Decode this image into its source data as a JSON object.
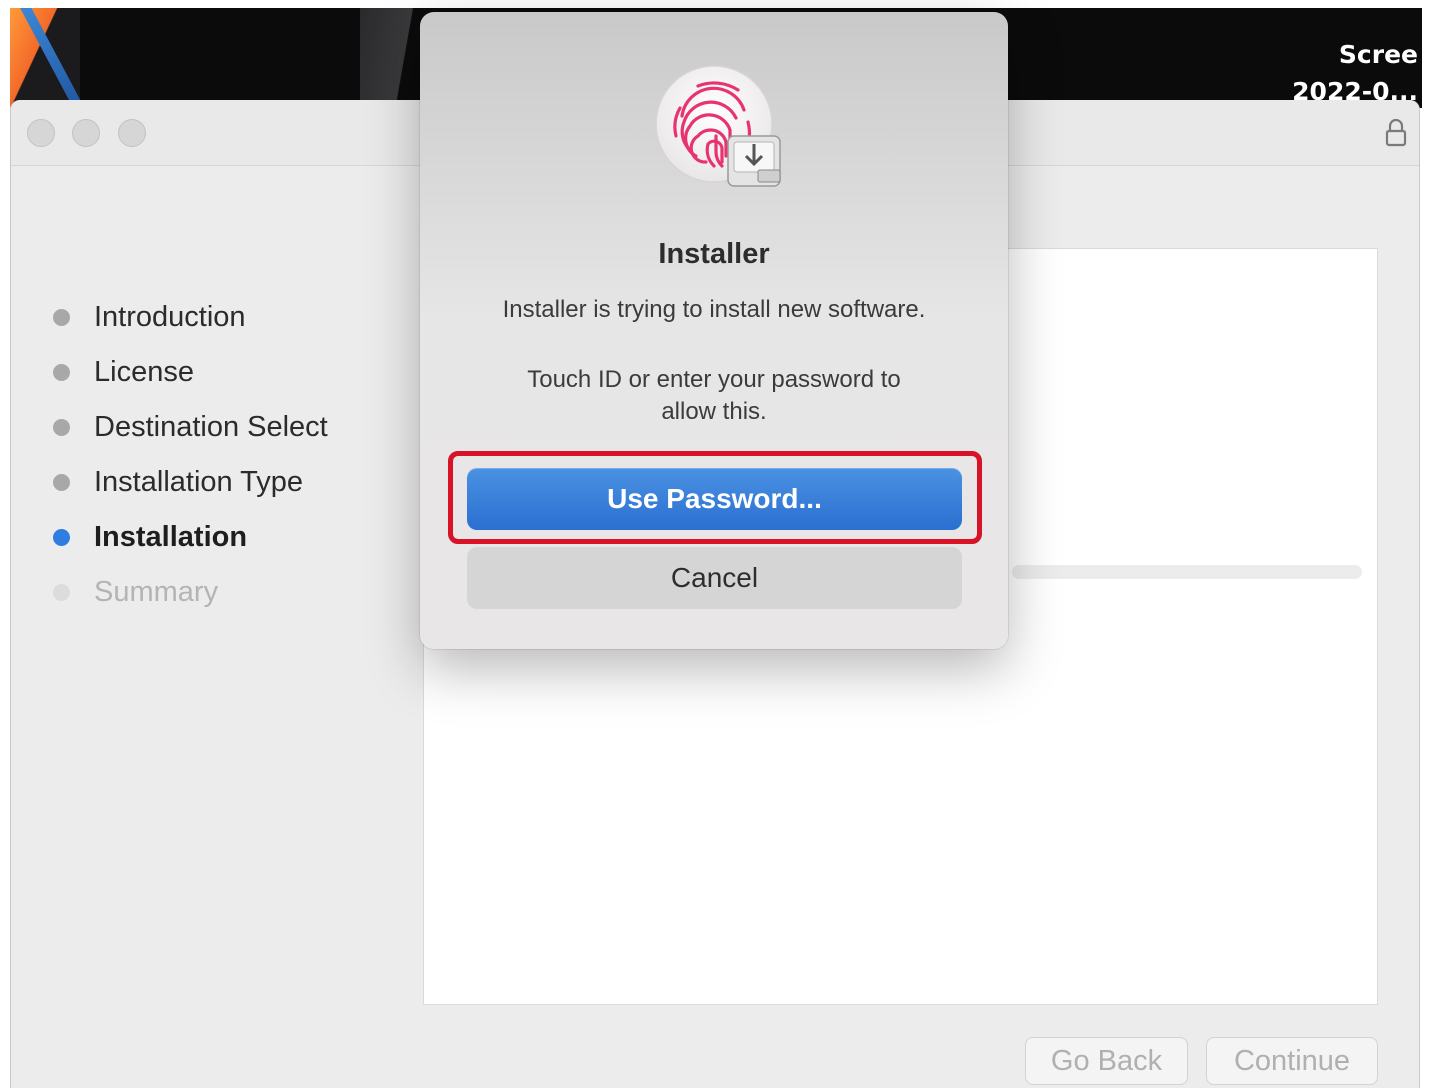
{
  "desktop": {
    "label_line1": "Scree",
    "label_line2": "2022-0..."
  },
  "window": {
    "traffic_lights": [
      "close-button",
      "minimize-button",
      "zoom-button"
    ],
    "lock_icon": "lock-icon"
  },
  "sidebar": {
    "steps": [
      {
        "label": "Introduction",
        "state": "done"
      },
      {
        "label": "License",
        "state": "done"
      },
      {
        "label": "Destination Select",
        "state": "done"
      },
      {
        "label": "Installation Type",
        "state": "done"
      },
      {
        "label": "Installation",
        "state": "current"
      },
      {
        "label": "Summary",
        "state": "pending"
      }
    ]
  },
  "footer": {
    "go_back_label": "Go Back",
    "continue_label": "Continue"
  },
  "dialog": {
    "icon": "touch-id-installer-icon",
    "title": "Installer",
    "message": "Installer is trying to install new software.",
    "prompt_line1": "Touch ID or enter your password to",
    "prompt_line2": "allow this.",
    "primary_button": "Use Password...",
    "cancel_button": "Cancel",
    "highlight_color": "#d81227"
  },
  "colors": {
    "accent": "#2f7de1",
    "primary_button": "#2b6fd0"
  }
}
